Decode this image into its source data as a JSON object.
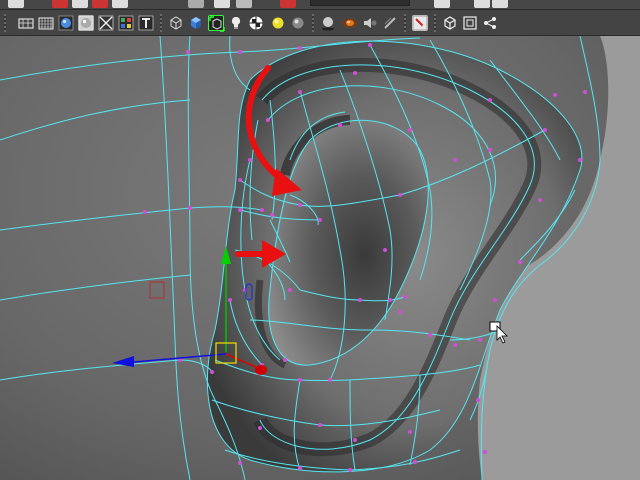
{
  "app": {
    "type": "3D modeling viewport",
    "panel": "perspective"
  },
  "toolbars": {
    "top": {
      "icons": [
        "file-icon",
        "marking-menu-icon",
        "select-icon",
        "move-icon",
        "rotate-icon",
        "scale-icon"
      ]
    },
    "main": {
      "icons": [
        "wireframe-icon",
        "grid-icon",
        "smooth-shade-icon",
        "smooth-shade-selected-icon",
        "xray-icon",
        "texture-icon",
        "cube-wire-icon",
        "cube-shaded-icon",
        "isolate-select-icon",
        "checker-icon",
        "light-icon",
        "sphere-icon",
        "shadow-icon",
        "material-icon",
        "audio-icon",
        "playblast-icon",
        "camera-icon",
        "frame-icon",
        "share-icon"
      ]
    }
  },
  "viewport": {
    "background_color": "#9b9b9b",
    "mesh_color": "#6a6a6a",
    "wireframe_color": "#55e6f0",
    "vertex_color": "#d04fd8",
    "annotations": [
      "curved-red-arrow",
      "straight-red-arrow"
    ],
    "manipulator": {
      "x_axis_color": "#e00000",
      "y_axis_color": "#00c000",
      "z_axis_color": "#1010e0",
      "center_color": "#f0e000"
    }
  }
}
